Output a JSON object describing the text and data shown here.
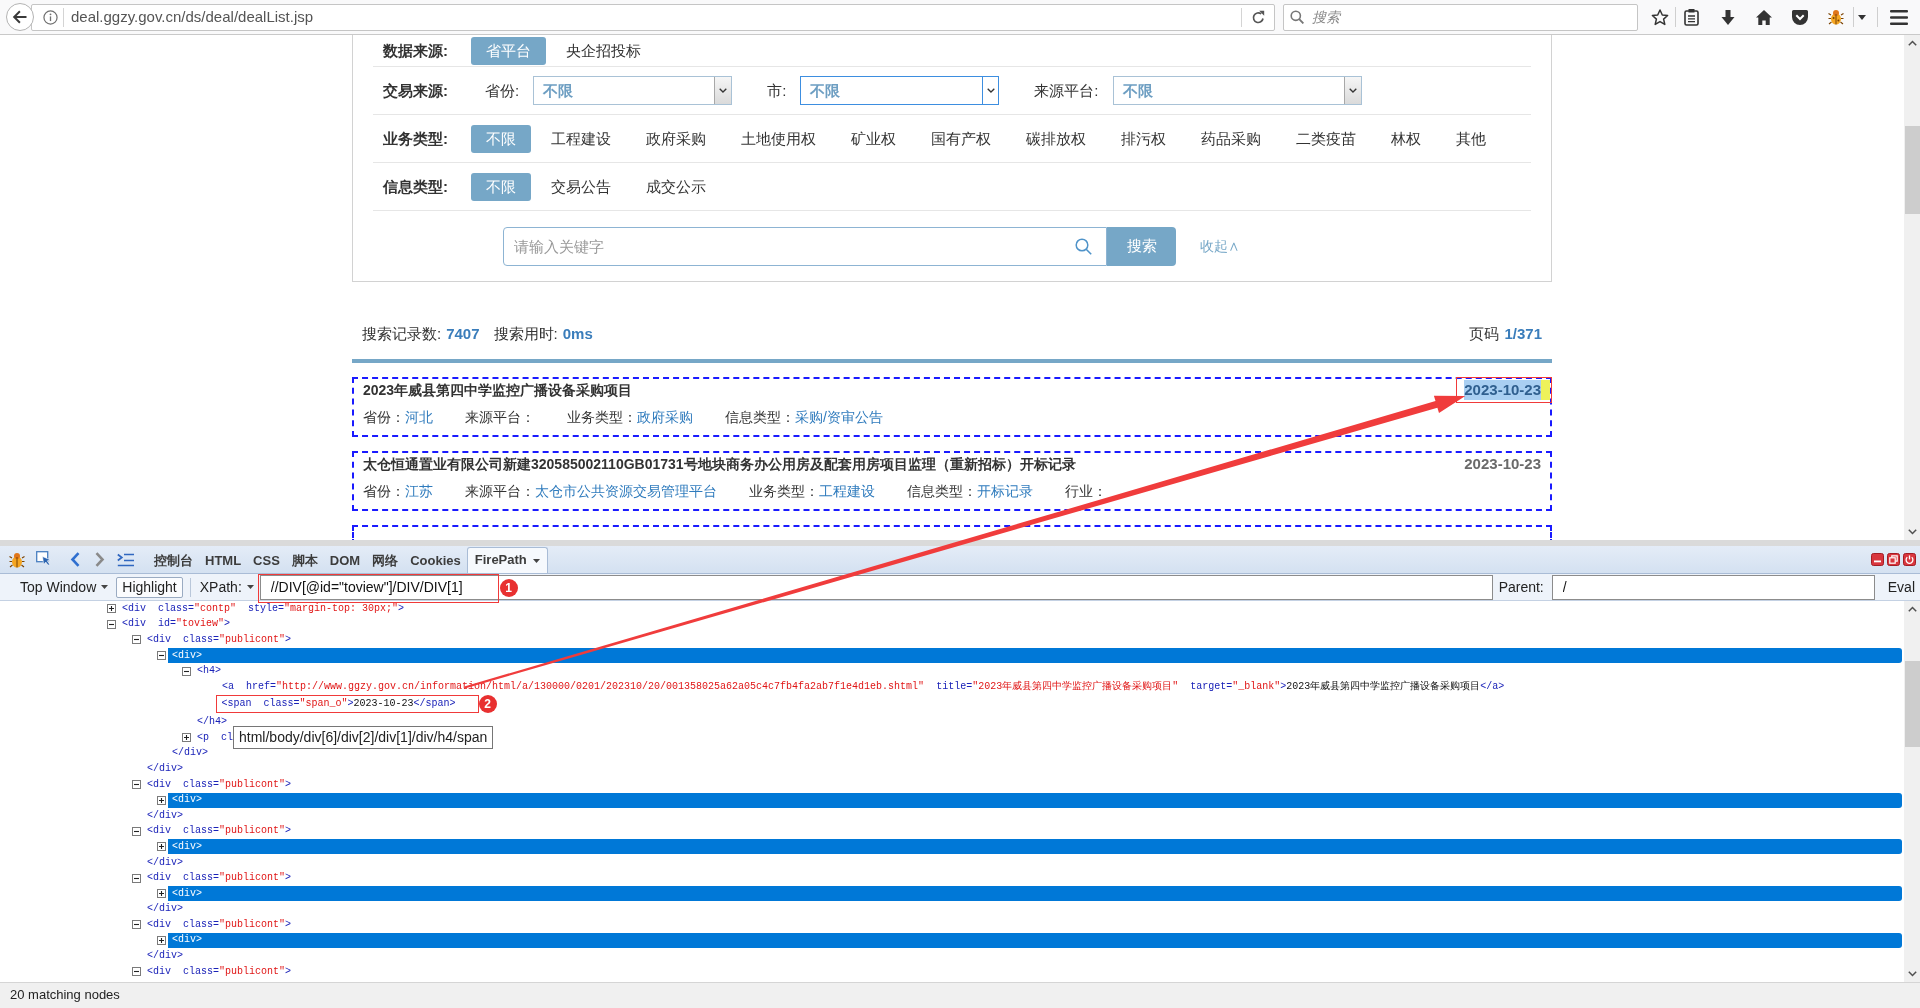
{
  "browser": {
    "url": "deal.ggzy.gov.cn/ds/deal/dealList.jsp",
    "search_placeholder": "搜索"
  },
  "filters": {
    "rows": [
      {
        "kind": "options",
        "label": "数据来源:",
        "options": [
          {
            "label": "省平台",
            "selected": true
          },
          {
            "label": "央企招投标",
            "selected": false
          }
        ]
      },
      {
        "kind": "selects",
        "label": "交易来源:",
        "selects": [
          {
            "label": "省份:",
            "value": "不限",
            "focused": false
          },
          {
            "label": "市:",
            "value": "不限",
            "focused": true
          },
          {
            "label": "来源平台:",
            "value": "不限",
            "focused": false
          }
        ]
      },
      {
        "kind": "options",
        "label": "业务类型:",
        "options": [
          {
            "label": "不限",
            "selected": true
          },
          {
            "label": "工程建设",
            "selected": false
          },
          {
            "label": "政府采购",
            "selected": false
          },
          {
            "label": "土地使用权",
            "selected": false
          },
          {
            "label": "矿业权",
            "selected": false
          },
          {
            "label": "国有产权",
            "selected": false
          },
          {
            "label": "碳排放权",
            "selected": false
          },
          {
            "label": "排污权",
            "selected": false
          },
          {
            "label": "药品采购",
            "selected": false
          },
          {
            "label": "二类疫苗",
            "selected": false
          },
          {
            "label": "林权",
            "selected": false
          },
          {
            "label": "其他",
            "selected": false
          }
        ]
      },
      {
        "kind": "options",
        "label": "信息类型:",
        "options": [
          {
            "label": "不限",
            "selected": true
          },
          {
            "label": "交易公告",
            "selected": false
          },
          {
            "label": "成交公示",
            "selected": false
          }
        ]
      }
    ],
    "search": {
      "placeholder": "请输入关键字",
      "button": "搜索",
      "toggle": "收起∧"
    }
  },
  "summary": {
    "count_label": "搜索记录数:",
    "count": "7407",
    "time_label": "搜索用时:",
    "time": "0ms",
    "page_label": "页码",
    "page": "1/371"
  },
  "results": [
    {
      "title": "2023年威县第四中学监控广播设备采购项目",
      "date": "2023-10-23",
      "highlighted": true,
      "annotated": true,
      "meta": [
        {
          "label": "省份：",
          "value": "河北"
        },
        {
          "label": "来源平台："
        },
        {
          "label": "业务类型：",
          "value": "政府采购"
        },
        {
          "label": "信息类型：",
          "value": "采购/资审公告"
        }
      ]
    },
    {
      "title": "太仓恒通置业有限公司新建320585002110GB01731号地块商务办公用房及配套用房项目监理（重新招标）开标记录",
      "date": "2023-10-23",
      "highlighted": false,
      "annotated": false,
      "meta": [
        {
          "label": "省份：",
          "value": "江苏"
        },
        {
          "label": "来源平台：",
          "value": "太仓市公共资源交易管理平台"
        },
        {
          "label": "业务类型：",
          "value": "工程建设"
        },
        {
          "label": "信息类型：",
          "value": "开标记录"
        },
        {
          "label": "行业："
        }
      ]
    }
  ],
  "devtools": {
    "tabs": [
      {
        "label": "控制台",
        "selected": false
      },
      {
        "label": "HTML",
        "selected": false
      },
      {
        "label": "CSS",
        "selected": false
      },
      {
        "label": "脚本",
        "selected": false
      },
      {
        "label": "DOM",
        "selected": false
      },
      {
        "label": "网络",
        "selected": false
      },
      {
        "label": "Cookies",
        "selected": false
      },
      {
        "label": "FirePath",
        "selected": true,
        "dropdown": true
      }
    ],
    "frame_menu": "Top Window",
    "highlight": {
      "label": "Highlight",
      "on": true
    },
    "xpath": {
      "label": "XPath:",
      "value": "//DIV[@id=\"toview\"]/DIV/DIV[1]",
      "marker": "1"
    },
    "parent": {
      "label": "Parent:",
      "value": "/"
    },
    "eval": "Eval",
    "nodes": [
      {
        "kind": "branch",
        "text": "<div  class=\"contp\"  style=\"margin-top: 30px;\">",
        "expanded": false,
        "matched": false
      },
      {
        "kind": "branch",
        "text": "<div  id=\"toview\">",
        "expanded": true,
        "matched": false,
        "children": [
          {
            "kind": "branch",
            "text": "<div  class=\"publicont\">",
            "expanded": true,
            "matched": false,
            "close": "</div>",
            "children": [
              {
                "kind": "branch",
                "text": "<div>",
                "expanded": true,
                "matched": true,
                "close": "</div>",
                "children": [
                  {
                    "kind": "branch",
                    "text": "<h4>",
                    "expanded": true,
                    "matched": false,
                    "close": "</h4>",
                    "children": [
                      {
                        "kind": "leaf",
                        "text": "<a  href=\"http://www.ggzy.gov.cn/information/html/a/130000/0201/202310/20/001358025a62a05c4c7fb4fa2ab7f1e4d1eb.shtml\"  title=\"2023年威县第四中学监控广播设备采购项目\"  target=\"_blank\">2023年威县第四中学监控广播设备采购项目</a>",
                        "matched": false
                      },
                      {
                        "kind": "leaf",
                        "text": "<span  class=\"span_o\">2023-10-23</span>",
                        "matched": false,
                        "marker": "2"
                      }
                    ]
                  },
                  {
                    "kind": "branch",
                    "text": "<p  cl",
                    "expanded": false,
                    "matched": false,
                    "tooltip": "html/body/div[6]/div[2]/div[1]/div/h4/span"
                  }
                ]
              }
            ]
          },
          {
            "kind": "branch",
            "text": "<div  class=\"publicont\">",
            "expanded": true,
            "matched": false,
            "close": "</div>",
            "children": [
              {
                "kind": "branch",
                "text": "<div>",
                "expanded": false,
                "matched": true
              }
            ]
          },
          {
            "kind": "branch",
            "text": "<div  class=\"publicont\">",
            "expanded": true,
            "matched": false,
            "close": "</div>",
            "children": [
              {
                "kind": "branch",
                "text": "<div>",
                "expanded": false,
                "matched": true
              }
            ]
          },
          {
            "kind": "branch",
            "text": "<div  class=\"publicont\">",
            "expanded": true,
            "matched": false,
            "close": "</div>",
            "children": [
              {
                "kind": "branch",
                "text": "<div>",
                "expanded": false,
                "matched": true
              }
            ]
          },
          {
            "kind": "branch",
            "text": "<div  class=\"publicont\">",
            "expanded": true,
            "matched": false,
            "close": "</div>",
            "children": [
              {
                "kind": "branch",
                "text": "<div>",
                "expanded": false,
                "matched": true
              }
            ]
          },
          {
            "kind": "branch",
            "text": "<div  class=\"publicont\">",
            "expanded": true,
            "matched": false
          }
        ]
      }
    ],
    "status": "20 matching nodes"
  }
}
